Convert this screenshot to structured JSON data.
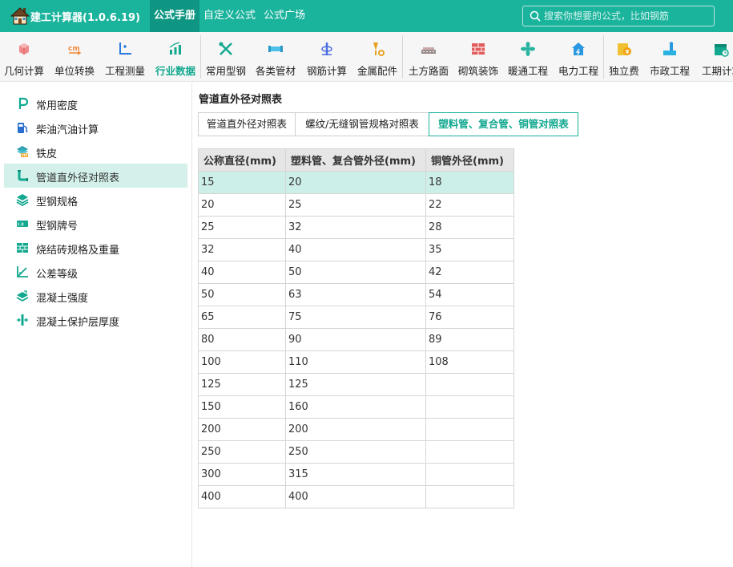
{
  "app": {
    "title": "建工计算器(1.0.6.19)"
  },
  "top_tabs": [
    {
      "label": "公式手册"
    },
    {
      "label": "自定义公式"
    },
    {
      "label": "公式广场"
    }
  ],
  "search": {
    "placeholder": "搜索你想要的公式，比如钢筋"
  },
  "toolbar": [
    {
      "label": "几何计算",
      "icon": "cube-icon"
    },
    {
      "label": "单位转换",
      "icon": "cm-convert-icon"
    },
    {
      "label": "工程测量",
      "icon": "axis-icon"
    },
    {
      "label": "行业数据",
      "icon": "chart-icon"
    },
    {
      "label": "常用型钢",
      "icon": "tools-icon"
    },
    {
      "label": "各类管材",
      "icon": "pipe-icon"
    },
    {
      "label": "钢筋计算",
      "icon": "rebar-icon"
    },
    {
      "label": "金属配件",
      "icon": "fitting-icon"
    },
    {
      "label": "土方路面",
      "icon": "road-icon"
    },
    {
      "label": "砌筑装饰",
      "icon": "brick-icon"
    },
    {
      "label": "暖通工程",
      "icon": "fan-icon"
    },
    {
      "label": "电力工程",
      "icon": "power-house-icon"
    },
    {
      "label": "独立费",
      "icon": "fee-icon"
    },
    {
      "label": "市政工程",
      "icon": "municipal-icon"
    },
    {
      "label": "工期计算",
      "icon": "calendar-icon"
    }
  ],
  "sidebar": [
    {
      "label": "常用密度",
      "icon": "density-icon"
    },
    {
      "label": "柴油汽油计算",
      "icon": "fuel-icon"
    },
    {
      "label": "铁皮",
      "icon": "sheet-vip-icon"
    },
    {
      "label": "管道直外径对照表",
      "icon": "pipe-elbow-icon"
    },
    {
      "label": "型钢规格",
      "icon": "layers-icon"
    },
    {
      "label": "型钢牌号",
      "icon": "steel-grade-icon"
    },
    {
      "label": "烧结砖规格及重量",
      "icon": "brick-wall-icon"
    },
    {
      "label": "公差等级",
      "icon": "tolerance-icon"
    },
    {
      "label": "混凝土强度",
      "icon": "concrete-icon"
    },
    {
      "label": "混凝土保护层厚度",
      "icon": "cover-thickness-icon"
    }
  ],
  "page": {
    "title": "管道直外径对照表",
    "sub_tabs": [
      {
        "label": "管道直外径对照表"
      },
      {
        "label": "螺纹/无缝钢管规格对照表"
      },
      {
        "label": "塑料管、复合管、铜管对照表"
      }
    ]
  },
  "table": {
    "headers": [
      "公称直径(mm)",
      "塑料管、复合管外径(mm)",
      "铜管外径(mm)"
    ],
    "rows": [
      [
        "15",
        "20",
        "18"
      ],
      [
        "20",
        "25",
        "22"
      ],
      [
        "25",
        "32",
        "28"
      ],
      [
        "32",
        "40",
        "35"
      ],
      [
        "40",
        "50",
        "42"
      ],
      [
        "50",
        "63",
        "54"
      ],
      [
        "65",
        "75",
        "76"
      ],
      [
        "80",
        "90",
        "89"
      ],
      [
        "100",
        "110",
        "108"
      ],
      [
        "125",
        "125",
        ""
      ],
      [
        "150",
        "160",
        ""
      ],
      [
        "200",
        "200",
        ""
      ],
      [
        "250",
        "250",
        ""
      ],
      [
        "300",
        "315",
        ""
      ],
      [
        "400",
        "400",
        ""
      ]
    ]
  },
  "colors": {
    "brand": "#1ab39c",
    "brand_dark": "#0e9682",
    "active_text": "#11a88f",
    "row_selected": "#cdefe9"
  }
}
